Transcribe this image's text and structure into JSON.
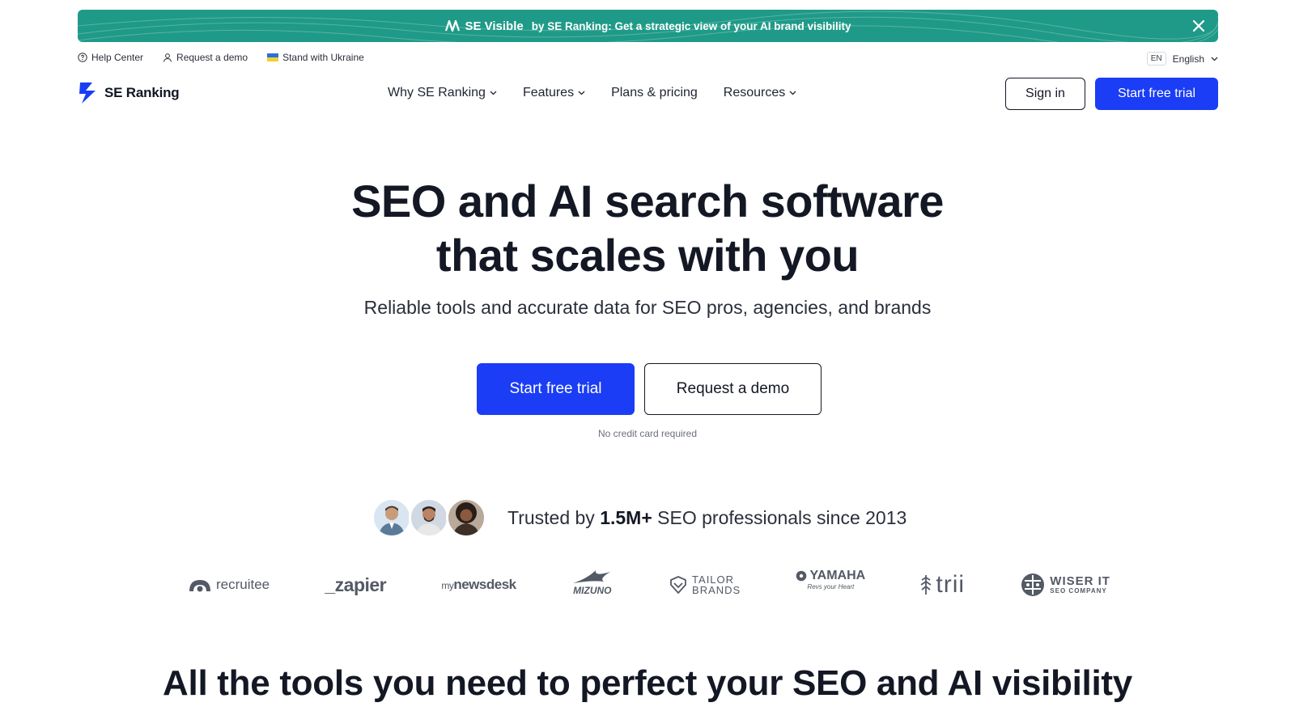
{
  "promo": {
    "brand": "SE Visible",
    "text": "by SE Ranking: Get a strategic view of your AI brand visibility",
    "icons": {
      "brand": "se-visible-logo-icon",
      "close": "close-icon"
    }
  },
  "utility": {
    "help_center": "Help Center",
    "request_demo": "Request a demo",
    "ukraine": "Stand with Ukraine",
    "lang_code": "EN",
    "lang_label": "English"
  },
  "nav": {
    "logo_text": "SE Ranking",
    "menu": [
      {
        "label": "Why SE Ranking",
        "has_dropdown": true
      },
      {
        "label": "Features",
        "has_dropdown": true
      },
      {
        "label": "Plans & pricing",
        "has_dropdown": false
      },
      {
        "label": "Resources",
        "has_dropdown": true
      }
    ],
    "sign_in": "Sign in",
    "start_trial": "Start free trial"
  },
  "hero": {
    "title_line1": "SEO and AI search software",
    "title_line2": "that scales with you",
    "subtitle": "Reliable tools and accurate data for SEO pros, agencies, and brands",
    "cta_primary": "Start free trial",
    "cta_secondary": "Request a demo",
    "note": "No credit card required"
  },
  "trust": {
    "prefix": "Trusted by",
    "highlight": "1.5M+",
    "suffix": "SEO professionals since 2013"
  },
  "clients": {
    "recruitee": "recruitee",
    "zapier": "_zapier",
    "newsdesk_prefix": "my",
    "newsdesk_main": "newsdesk",
    "mizuno": "MIZUNO",
    "tailor_line1": "TAILOR",
    "tailor_line2": "BRANDS",
    "yamaha": "YAMAHA",
    "yamaha_tag": "Revs your Heart",
    "trii": "trii",
    "wiser_main": "WISER IT",
    "wiser_sub": "SEO COMPANY"
  },
  "section": {
    "title": "All the tools you need to perfect your SEO and AI visibility"
  },
  "colors": {
    "promo_bg": "#1f9a88",
    "primary": "#1a3df5",
    "text": "#141824",
    "logo_gray": "#545966"
  }
}
